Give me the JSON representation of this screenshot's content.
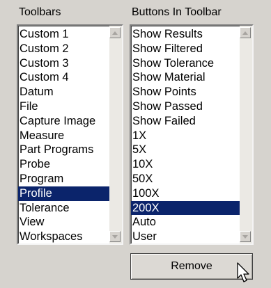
{
  "toolbars": {
    "label": "Toolbars",
    "items": [
      "Custom 1",
      "Custom 2",
      "Custom 3",
      "Custom 4",
      "Datum",
      "File",
      "Capture Image",
      "Measure",
      "Part Programs",
      "Probe",
      "Program",
      "Profile",
      "Tolerance",
      "View",
      "Workspaces"
    ],
    "selected_index": 11
  },
  "buttons": {
    "label": "Buttons In Toolbar",
    "items": [
      "Show Results",
      "Show Filtered",
      "Show Tolerance",
      "Show Material",
      "Show Points",
      "Show Passed",
      "Show Failed",
      "1X",
      "5X",
      "10X",
      "50X",
      "100X",
      "200X",
      "Auto",
      "User"
    ],
    "selected_index": 12
  },
  "actions": {
    "remove_label": "Remove"
  },
  "colors": {
    "selection": "#0b246b",
    "window_bg": "#d6d3ce"
  },
  "icons": {
    "cursor": "arrow-pointer-icon",
    "scroll_up": "scroll-up-arrow-icon",
    "scroll_down": "scroll-down-arrow-icon"
  }
}
